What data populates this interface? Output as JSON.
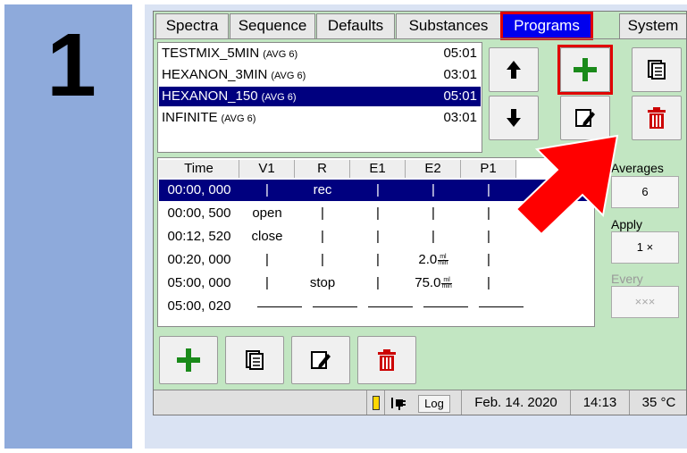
{
  "step": {
    "number": "1"
  },
  "tabs": [
    {
      "label": "Spectra"
    },
    {
      "label": "Sequence"
    },
    {
      "label": "Defaults"
    },
    {
      "label": "Substances"
    },
    {
      "label": "Programs",
      "active": true
    },
    {
      "label": "System"
    }
  ],
  "programs": [
    {
      "name": "TESTMIX_5MIN",
      "avg": "(AVG 6)",
      "time": "05:01"
    },
    {
      "name": "HEXANON_3MIN",
      "avg": "(AVG 6)",
      "time": "03:01"
    },
    {
      "name": "HEXANON_150",
      "avg": "(AVG 6)",
      "time": "05:01",
      "selected": true
    },
    {
      "name": "INFINITE",
      "avg": "(AVG 6)",
      "time": "03:01"
    }
  ],
  "table": {
    "headers": [
      "Time",
      "V1",
      "R",
      "E1",
      "E2",
      "P1"
    ],
    "rows": [
      {
        "time": "00:00, 000",
        "v1": "|",
        "r": "rec",
        "e1": "|",
        "e2": "|",
        "p1": "|",
        "selected": true
      },
      {
        "time": "00:00, 500",
        "v1": "open",
        "r": "|",
        "e1": "|",
        "e2": "|",
        "p1": "|"
      },
      {
        "time": "00:12, 520",
        "v1": "close",
        "r": "|",
        "e1": "|",
        "e2": "|",
        "p1": "|"
      },
      {
        "time": "00:20, 000",
        "v1": "|",
        "r": "|",
        "e1": "|",
        "e2": "2.0",
        "e2_unit_num": "ml",
        "e2_unit_den": "min",
        "p1": "|"
      },
      {
        "time": "05:00, 000",
        "v1": "|",
        "r": "stop",
        "e1": "|",
        "e2": "75.0",
        "e2_unit_num": "ml",
        "e2_unit_den": "min",
        "p1": "|"
      },
      {
        "time": "05:00, 020",
        "end": true
      }
    ]
  },
  "settings": {
    "averages_label": "Averages",
    "averages_value": "6",
    "apply_label": "Apply",
    "apply_value": "1 ×",
    "every_label": "Every",
    "every_value": "×××"
  },
  "icons": {
    "move_up": "arrow-up-icon",
    "move_down": "arrow-down-icon",
    "add": "plus-icon",
    "copy": "copy-icon",
    "edit": "edit-icon",
    "delete": "trash-icon",
    "battery": "battery-icon",
    "plug": "plug-icon",
    "callout": "red-arrow-pointer"
  },
  "status": {
    "log_label": "Log",
    "date": "Feb. 14. 2020",
    "time": "14:13",
    "temperature": "35 °C"
  },
  "colors": {
    "selection": "#00007f",
    "active_tab": "#0000ee",
    "highlight": "#e00000",
    "add_green": "#1a8a1a",
    "delete_red": "#cc0000",
    "app_bg": "#c2e6c2",
    "step_panel": "#8eaadb"
  }
}
